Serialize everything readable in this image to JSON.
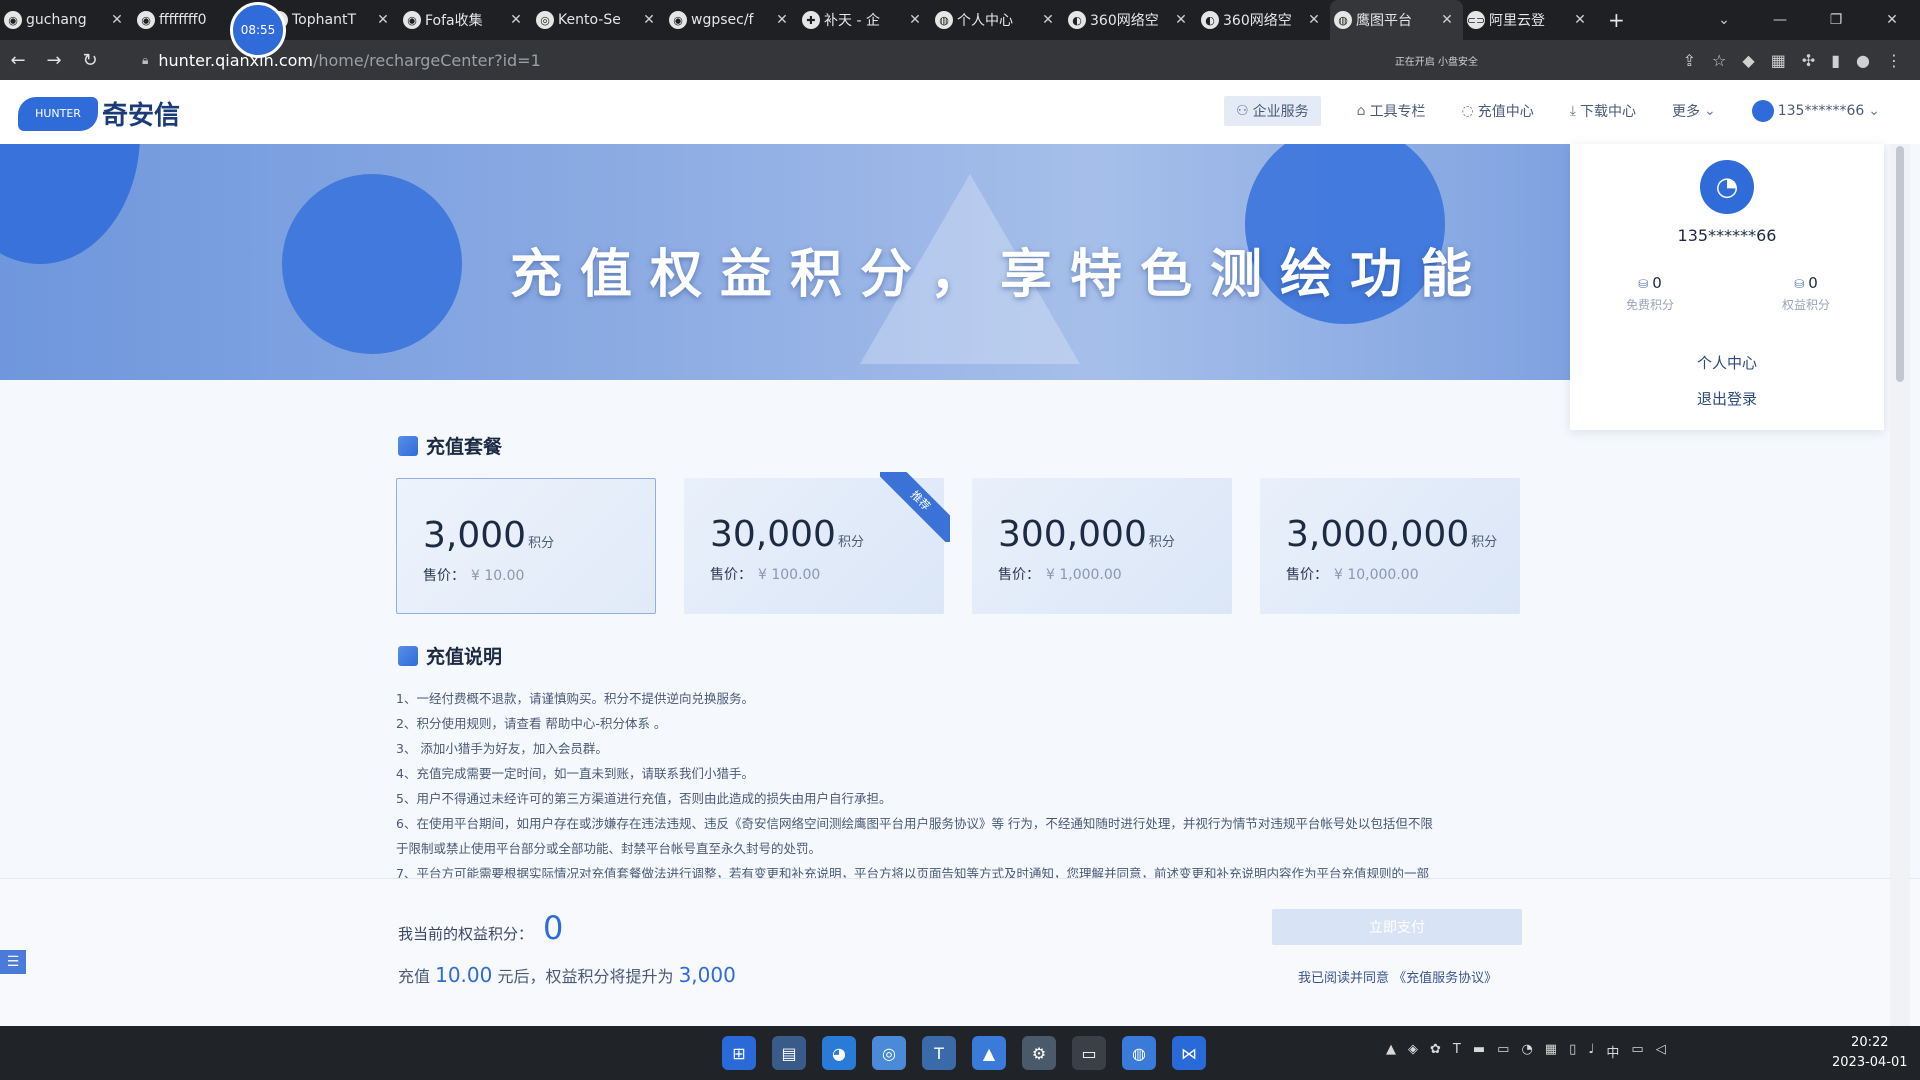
{
  "browser": {
    "tabs": [
      {
        "label": "guchang",
        "icon": "github-icon"
      },
      {
        "label": "ffffffff0",
        "icon": "github-icon"
      },
      {
        "label": "TophantT",
        "icon": "github-icon"
      },
      {
        "label": "Fofa收集",
        "icon": "github-icon"
      },
      {
        "label": "Kento-Se",
        "icon": "globe-icon"
      },
      {
        "label": "wgpsec/f",
        "icon": "github-icon"
      },
      {
        "label": "补天 - 企",
        "icon": "butian-icon"
      },
      {
        "label": "个人中心",
        "icon": "hunter-icon"
      },
      {
        "label": "360网络空",
        "icon": "360-icon"
      },
      {
        "label": "360网络空",
        "icon": "360-icon"
      },
      {
        "label": "鹰图平台",
        "icon": "hunter-icon",
        "active": true
      },
      {
        "label": "阿里云登",
        "icon": "aliyun-icon"
      }
    ],
    "recorder_time": "08:55",
    "url_host": "hunter.qianxin.com",
    "url_path": "/home/rechargeCenter?id=1",
    "scanning_text": "正在开启 小盘安全"
  },
  "site": {
    "logo_text": "奇安信",
    "logo_mark_text": "HUNTER",
    "nav": {
      "enterprise": "企业服务",
      "tools": "工具专栏",
      "recharge": "充值中心",
      "download": "下载中心",
      "more": "更多",
      "user": "135******66"
    }
  },
  "banner": {
    "title": "充值权益积分，享特色测绘功能"
  },
  "user_panel": {
    "username": "135******66",
    "free_points_value": "0",
    "free_points_label": "免费积分",
    "rights_points_value": "0",
    "rights_points_label": "权益积分",
    "personal_center": "个人中心",
    "logout": "退出登录"
  },
  "packages": {
    "section_title": "充值套餐",
    "unit": "积分",
    "price_label": "售价：",
    "recommend_badge": "推荐",
    "items": [
      {
        "amount": "3,000",
        "price": "¥ 10.00"
      },
      {
        "amount": "30,000",
        "price": "¥ 100.00"
      },
      {
        "amount": "300,000",
        "price": "¥ 1,000.00"
      },
      {
        "amount": "3,000,000",
        "price": "¥ 10,000.00"
      }
    ]
  },
  "notes": {
    "section_title": "充值说明",
    "lines": [
      "1、一经付费概不退款，请谨慎购买。积分不提供逆向兑换服务。",
      "2、积分使用规则，请查看 帮助中心-积分体系 。",
      "3、 添加小猎手为好友，加入会员群。",
      "4、充值完成需要一定时间，如一直未到账，请联系我们小猎手。",
      "5、用户不得通过未经许可的第三方渠道进行充值，否则由此造成的损失由用户自行承担。",
      "6、在使用平台期间，如用户存在或涉嫌存在违法违规、违反《奇安信网络空间测绘鹰图平台用户服务协议》等 行为，不经通知随时进行处理，并视行为情节对违规平台帐号处以包括但不限",
      "于限制或禁止使用平台部分或全部功能、封禁平台帐号直至永久封号的处罚。",
      "7、平台方可能需要根据实际情况对充值套餐做法进行调整，若有变更和补充说明，平台方将以页面告知等方式及时通知，您理解并同意，前述变更和补充说明内容作为平台充值规则的一部"
    ]
  },
  "summary": {
    "current_label": "我当前的权益积分：",
    "current_value": "0",
    "after_prefix": "充值",
    "after_amount": "10.00",
    "after_mid": "元后，权益积分将提升为",
    "after_points": "3,000",
    "pay_button": "立即支付",
    "agree_text": "我已阅读并同意 《充值服务协议》"
  },
  "taskbar": {
    "time": "20:22",
    "date": "2023-04-01",
    "ime": "中"
  }
}
